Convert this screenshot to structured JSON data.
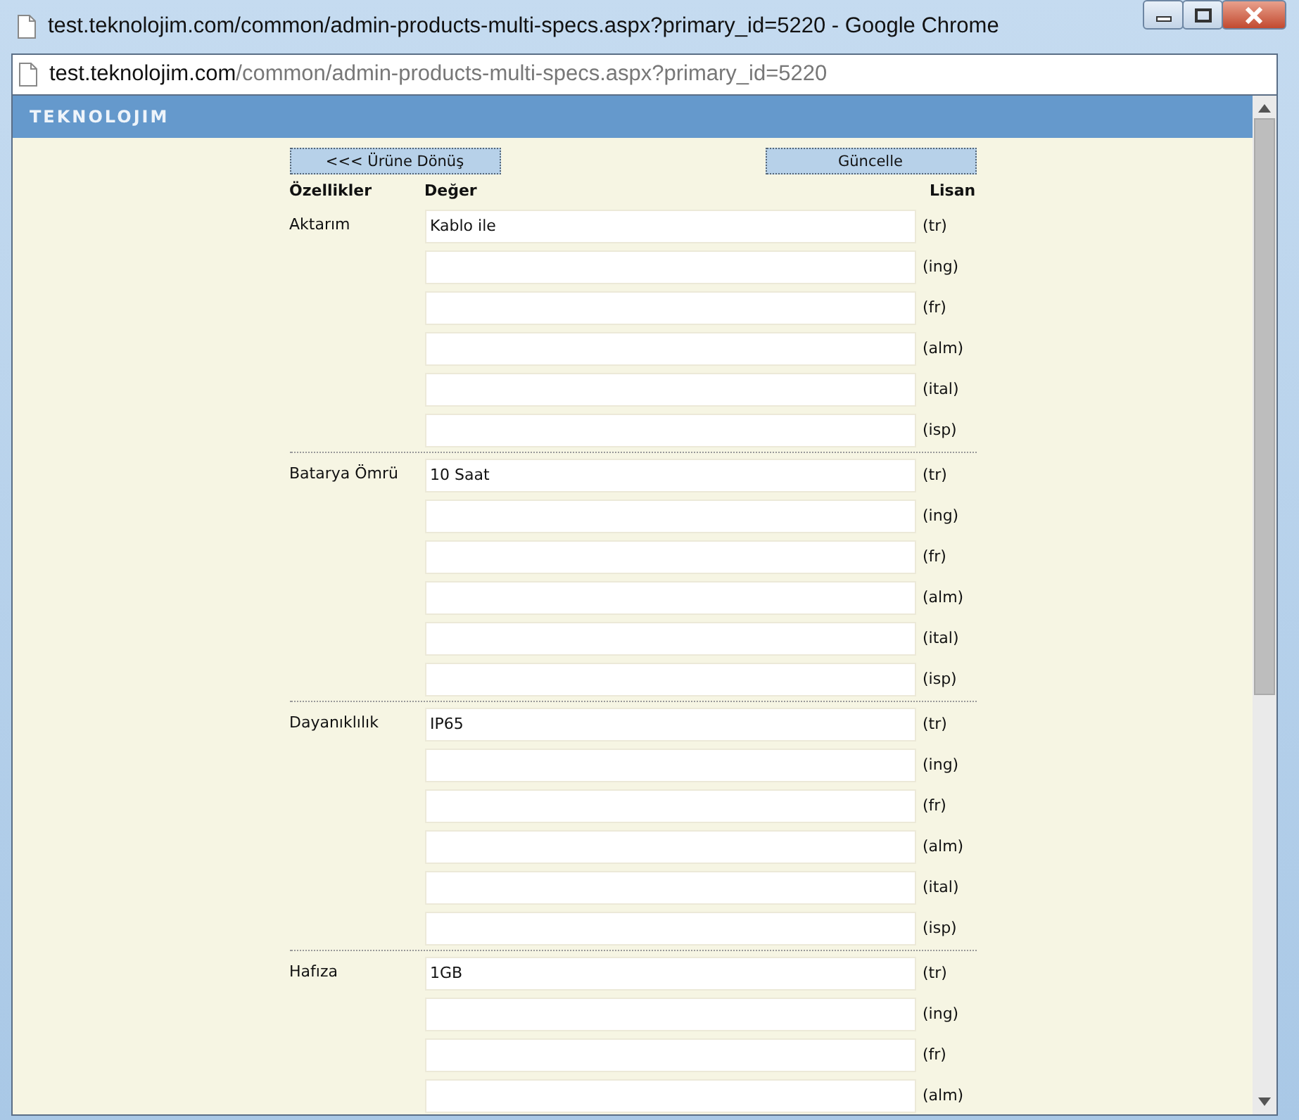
{
  "window": {
    "title": "test.teknolojim.com/common/admin-products-multi-specs.aspx?primary_id=5220 - Google Chrome"
  },
  "address_bar": {
    "host": "test.teknolojim.com",
    "path": "/common/admin-products-multi-specs.aspx?primary_id=5220"
  },
  "header": {
    "logo": "TEKNOLOJIM"
  },
  "buttons": {
    "back": "<<< Ürüne Dönüş",
    "update": "Güncelle"
  },
  "columns": [
    "Özellikler",
    "Değer",
    "Lisan"
  ],
  "specs": [
    {
      "name": "Aktarım",
      "values": [
        {
          "value": "Kablo ile",
          "lang": "(tr)"
        },
        {
          "lang": "(ing)"
        },
        {
          "lang": "(fr)"
        },
        {
          "lang": "(alm)"
        },
        {
          "lang": "(ital)"
        },
        {
          "lang": "(isp)"
        }
      ]
    },
    {
      "name": "Batarya Ömrü",
      "values": [
        {
          "value": "10 Saat",
          "lang": "(tr)"
        },
        {
          "lang": "(ing)"
        },
        {
          "lang": "(fr)"
        },
        {
          "lang": "(alm)"
        },
        {
          "lang": "(ital)"
        },
        {
          "lang": "(isp)"
        }
      ]
    },
    {
      "name": "Dayanıklılık",
      "values": [
        {
          "value": "IP65",
          "lang": "(tr)"
        },
        {
          "lang": "(ing)"
        },
        {
          "lang": "(fr)"
        },
        {
          "lang": "(alm)"
        },
        {
          "lang": "(ital)"
        },
        {
          "lang": "(isp)"
        }
      ]
    },
    {
      "name": "Hafıza",
      "values": [
        {
          "value": "1GB",
          "lang": "(tr)"
        },
        {
          "lang": "(ing)"
        },
        {
          "lang": "(fr)"
        },
        {
          "lang": "(alm)"
        }
      ]
    }
  ]
}
